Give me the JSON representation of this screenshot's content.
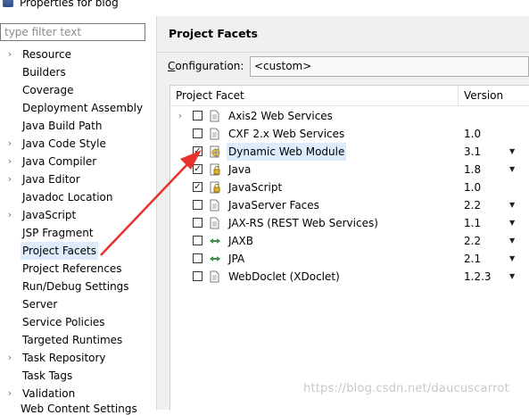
{
  "window": {
    "title": "Properties for blog"
  },
  "filter": {
    "placeholder": "type filter text"
  },
  "tree": [
    {
      "label": "Resource",
      "expandable": true
    },
    {
      "label": "Builders",
      "expandable": false
    },
    {
      "label": "Coverage",
      "expandable": false
    },
    {
      "label": "Deployment Assembly",
      "expandable": false
    },
    {
      "label": "Java Build Path",
      "expandable": false
    },
    {
      "label": "Java Code Style",
      "expandable": true
    },
    {
      "label": "Java Compiler",
      "expandable": true
    },
    {
      "label": "Java Editor",
      "expandable": true
    },
    {
      "label": "Javadoc Location",
      "expandable": false
    },
    {
      "label": "JavaScript",
      "expandable": true
    },
    {
      "label": "JSP Fragment",
      "expandable": false
    },
    {
      "label": "Project Facets",
      "expandable": false,
      "selected": true
    },
    {
      "label": "Project References",
      "expandable": false
    },
    {
      "label": "Run/Debug Settings",
      "expandable": false
    },
    {
      "label": "Server",
      "expandable": false
    },
    {
      "label": "Service Policies",
      "expandable": false
    },
    {
      "label": "Targeted Runtimes",
      "expandable": false
    },
    {
      "label": "Task Repository",
      "expandable": true
    },
    {
      "label": "Task Tags",
      "expandable": false
    },
    {
      "label": "Validation",
      "expandable": true
    }
  ],
  "tree_bottom_partial": "Web Content Settings",
  "page": {
    "title": "Project Facets",
    "configuration_label_accel": "C",
    "configuration_label_rest": "onfiguration:",
    "configuration_value": "<custom>",
    "col_facet": "Project Facet",
    "col_version": "Version"
  },
  "facets": [
    {
      "name": "Axis2 Web Services",
      "version": "",
      "checked": false,
      "expandable": true,
      "icon": "document-icon",
      "dropdown": false
    },
    {
      "name": "CXF 2.x Web Services",
      "version": "1.0",
      "checked": false,
      "expandable": false,
      "icon": "document-icon",
      "dropdown": false
    },
    {
      "name": "Dynamic Web Module",
      "version": "3.1",
      "checked": true,
      "expandable": false,
      "icon": "web-module-icon",
      "dropdown": true,
      "highlight": true
    },
    {
      "name": "Java",
      "version": "1.8",
      "checked": true,
      "expandable": false,
      "icon": "locked-document-icon",
      "dropdown": true
    },
    {
      "name": "JavaScript",
      "version": "1.0",
      "checked": true,
      "expandable": false,
      "icon": "locked-document-icon",
      "dropdown": false
    },
    {
      "name": "JavaServer Faces",
      "version": "2.2",
      "checked": false,
      "expandable": false,
      "icon": "document-icon",
      "dropdown": true
    },
    {
      "name": "JAX-RS (REST Web Services)",
      "version": "1.1",
      "checked": false,
      "expandable": false,
      "icon": "document-icon",
      "dropdown": true
    },
    {
      "name": "JAXB",
      "version": "2.2",
      "checked": false,
      "expandable": false,
      "icon": "arrows-icon",
      "dropdown": true
    },
    {
      "name": "JPA",
      "version": "2.1",
      "checked": false,
      "expandable": false,
      "icon": "arrows-icon",
      "dropdown": true
    },
    {
      "name": "WebDoclet (XDoclet)",
      "version": "1.2.3",
      "checked": false,
      "expandable": false,
      "icon": "document-icon",
      "dropdown": true
    }
  ],
  "watermark": "https://blog.csdn.net/daucuscarrot",
  "colors": {
    "selection": "#dcecfc",
    "annotation_arrow": "#e8322d"
  }
}
